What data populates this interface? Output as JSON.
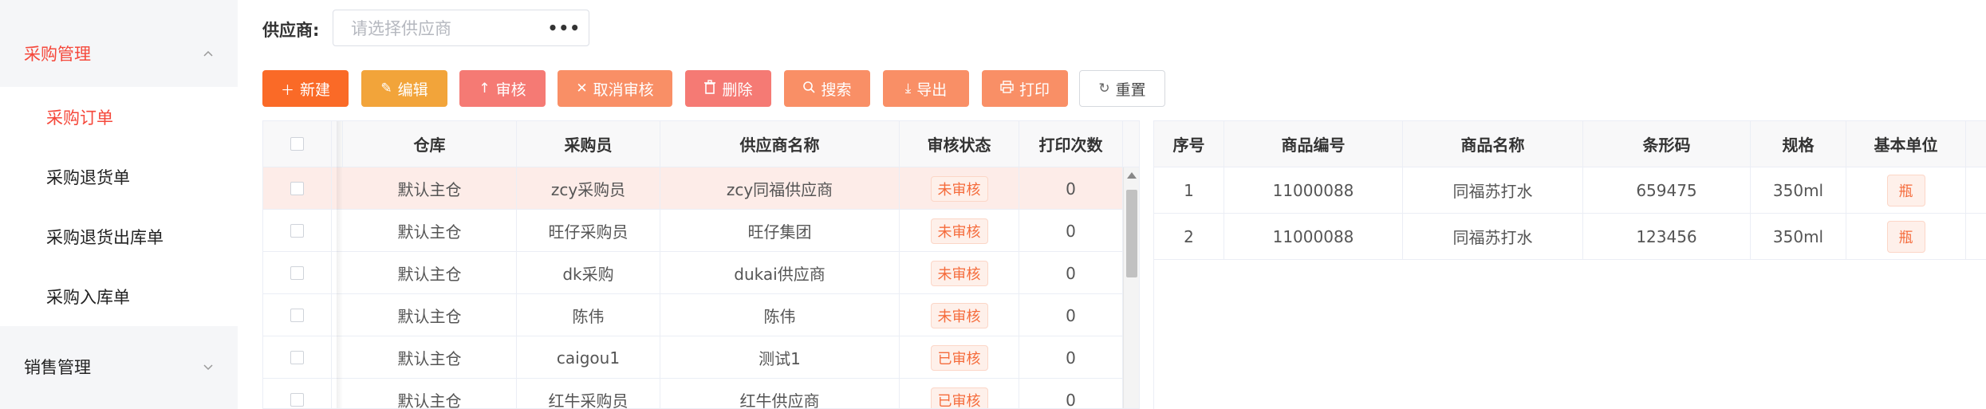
{
  "sidebar": {
    "groups": [
      {
        "label": "采购管理",
        "expanded": true,
        "active": true
      },
      {
        "label": "销售管理",
        "expanded": false,
        "active": false
      }
    ],
    "items": [
      {
        "label": "采购订单",
        "active": true
      },
      {
        "label": "采购退货单",
        "active": false
      },
      {
        "label": "采购退货出库单",
        "active": false
      },
      {
        "label": "采购入库单",
        "active": false
      }
    ]
  },
  "filter": {
    "supplier_label": "供应商:",
    "supplier_placeholder": "请选择供应商",
    "more_icon": "ellipsis-icon"
  },
  "toolbar": {
    "buttons": [
      {
        "label": "新建",
        "icon": "plus-icon",
        "color": "#fa6a27"
      },
      {
        "label": "编辑",
        "icon": "edit-icon",
        "color": "#f2a43a"
      },
      {
        "label": "审核",
        "icon": "arrow-up-icon",
        "color": "#f57a74"
      },
      {
        "label": "取消审核",
        "icon": "close-icon",
        "color": "#f98f66"
      },
      {
        "label": "删除",
        "icon": "trash-icon",
        "color": "#f57a74"
      },
      {
        "label": "搜索",
        "icon": "search-icon",
        "color": "#f98f66"
      },
      {
        "label": "导出",
        "icon": "download-icon",
        "color": "#f98f66"
      },
      {
        "label": "打印",
        "icon": "printer-icon",
        "color": "#f98f66"
      },
      {
        "label": "重置",
        "icon": "refresh-icon",
        "color": "#ffffff"
      }
    ]
  },
  "orders": {
    "columns": [
      "",
      "仓库",
      "采购员",
      "供应商名称",
      "审核状态",
      "打印次数"
    ],
    "rows": [
      {
        "warehouse": "默认主仓",
        "buyer": "zcy采购员",
        "supplier": "zcy同福供应商",
        "status": "未审核",
        "prints": "0",
        "selected": true
      },
      {
        "warehouse": "默认主仓",
        "buyer": "旺仔采购员",
        "supplier": "旺仔集团",
        "status": "未审核",
        "prints": "0",
        "selected": false
      },
      {
        "warehouse": "默认主仓",
        "buyer": "dk采购",
        "supplier": "dukai供应商",
        "status": "未审核",
        "prints": "0",
        "selected": false
      },
      {
        "warehouse": "默认主仓",
        "buyer": "陈伟",
        "supplier": "陈伟",
        "status": "未审核",
        "prints": "0",
        "selected": false
      },
      {
        "warehouse": "默认主仓",
        "buyer": "caigou1",
        "supplier": "测试1",
        "status": "已审核",
        "prints": "0",
        "selected": false
      },
      {
        "warehouse": "默认主仓",
        "buyer": "红牛采购员",
        "supplier": "红牛供应商",
        "status": "已审核",
        "prints": "0",
        "selected": false
      }
    ]
  },
  "details": {
    "columns": [
      "序号",
      "商品编号",
      "商品名称",
      "条形码",
      "规格",
      "基本单位"
    ],
    "rows": [
      {
        "no": "1",
        "code": "11000088",
        "name": "同福苏打水",
        "barcode": "659475",
        "spec": "350ml",
        "unit": "瓶"
      },
      {
        "no": "2",
        "code": "11000088",
        "name": "同福苏打水",
        "barcode": "123456",
        "spec": "350ml",
        "unit": "瓶"
      }
    ]
  },
  "colors": {
    "accent": "#f5483b",
    "status_tag": "#f56c3c",
    "selected_row": "#fdece8"
  }
}
